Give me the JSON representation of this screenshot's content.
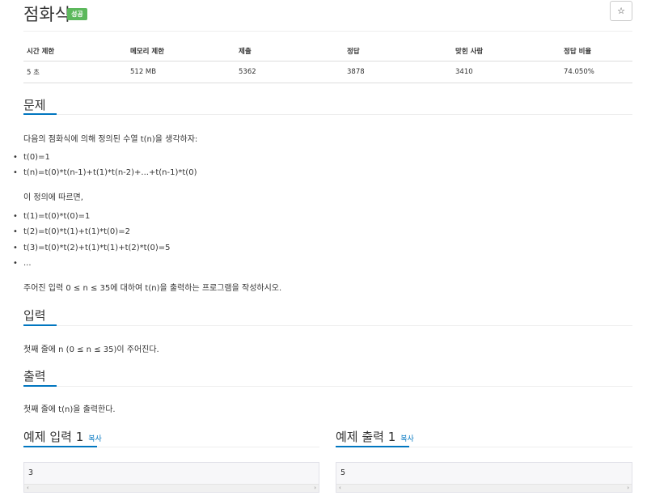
{
  "header": {
    "title": "점화식",
    "badge": "성공",
    "star_icon": "☆"
  },
  "info_table": {
    "headers": [
      "시간 제한",
      "메모리 제한",
      "제출",
      "정답",
      "맞힌 사람",
      "정답 비율"
    ],
    "values": [
      "5 초",
      "512 MB",
      "5362",
      "3878",
      "3410",
      "74.050%"
    ]
  },
  "problem": {
    "heading": "문제",
    "intro": "다음의 점화식에 의해 정의된 수열 t(n)을 생각하자:",
    "definition": [
      "t(0)=1",
      "t(n)=t(0)*t(n-1)+t(1)*t(n-2)+...+t(n-1)*t(0)"
    ],
    "follow_text": "이 정의에 따르면,",
    "examples": [
      "t(1)=t(0)*t(0)=1",
      "t(2)=t(0)*t(1)+t(1)*t(0)=2",
      "t(3)=t(0)*t(2)+t(1)*t(1)+t(2)*t(0)=5",
      "..."
    ],
    "task": "주어진 입력 0 ≤ n ≤ 35에 대하여 t(n)을 출력하는 프로그램을 작성하시오."
  },
  "input_section": {
    "heading": "입력",
    "text": "첫째 줄에 n (0 ≤ n ≤ 35)이 주어진다."
  },
  "output_section": {
    "heading": "출력",
    "text": "첫째 줄에 t(n)을 출력한다."
  },
  "sample_input": {
    "heading": "예제 입력 1",
    "copy_label": "복사",
    "value": "3"
  },
  "sample_output": {
    "heading": "예제 출력 1",
    "copy_label": "복사",
    "value": "5"
  },
  "colors": {
    "accent": "#0076c0",
    "badge": "#5cb85c"
  }
}
